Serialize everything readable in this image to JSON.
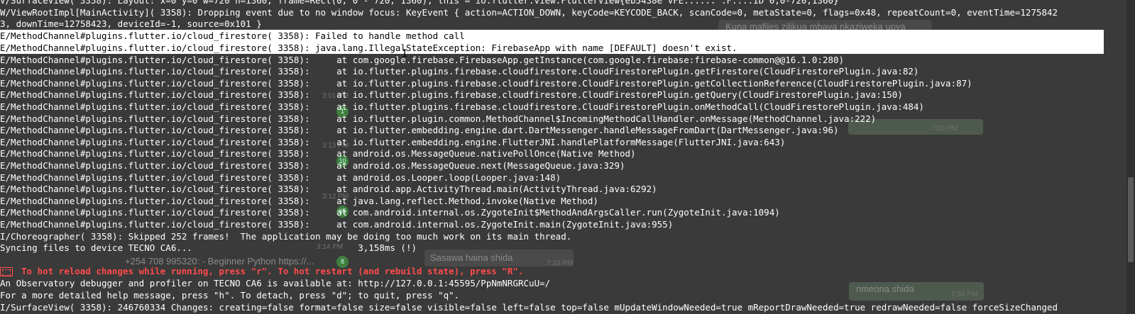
{
  "terminal": {
    "lines": [
      "V/SurfaceView( 3358): Layout: x=0 y=0 w=720 h=1360, frame=Rect(0, 0 - 720, 1360); this = io.flutter.view.FlutterView{eb5438e VFE...... .F....ID 0,0-720,1360}",
      "W/ViewRootImpl[MainActivity]( 3358): Dropping event due to no window focus: KeyEvent { action=ACTION_DOWN, keyCode=KEYCODE_BACK, scanCode=0, metaState=0, flags=0x48, repeatCount=0, eventTime=1275842",
      "3, downTime=12758423, deviceId=-1, source=0x101 }",
      "E/MethodChannel#plugins.flutter.io/cloud_firestore( 3358): Failed to handle method call",
      "E/MethodChannel#plugins.flutter.io/cloud_firestore( 3358): java.lang.IllegalStateException: FirebaseApp with name [DEFAULT] doesn't exist.",
      "E/MethodChannel#plugins.flutter.io/cloud_firestore( 3358):     at com.google.firebase.FirebaseApp.getInstance(com.google.firebase:firebase-common@@16.1.0:280)",
      "E/MethodChannel#plugins.flutter.io/cloud_firestore( 3358):     at io.flutter.plugins.firebase.cloudfirestore.CloudFirestorePlugin.getFirestore(CloudFirestorePlugin.java:82)",
      "E/MethodChannel#plugins.flutter.io/cloud_firestore( 3358):     at io.flutter.plugins.firebase.cloudfirestore.CloudFirestorePlugin.getCollectionReference(CloudFirestorePlugin.java:87)",
      "E/MethodChannel#plugins.flutter.io/cloud_firestore( 3358):     at io.flutter.plugins.firebase.cloudfirestore.CloudFirestorePlugin.getQuery(CloudFirestorePlugin.java:150)",
      "E/MethodChannel#plugins.flutter.io/cloud_firestore( 3358):     at io.flutter.plugins.firebase.cloudfirestore.CloudFirestorePlugin.onMethodCall(CloudFirestorePlugin.java:484)",
      "E/MethodChannel#plugins.flutter.io/cloud_firestore( 3358):     at io.flutter.plugin.common.MethodChannel$IncomingMethodCallHandler.onMessage(MethodChannel.java:222)",
      "E/MethodChannel#plugins.flutter.io/cloud_firestore( 3358):     at io.flutter.embedding.engine.dart.DartMessenger.handleMessageFromDart(DartMessenger.java:96)",
      "E/MethodChannel#plugins.flutter.io/cloud_firestore( 3358):     at io.flutter.embedding.engine.FlutterJNI.handlePlatformMessage(FlutterJNI.java:643)",
      "E/MethodChannel#plugins.flutter.io/cloud_firestore( 3358):     at android.os.MessageQueue.nativePollOnce(Native Method)",
      "E/MethodChannel#plugins.flutter.io/cloud_firestore( 3358):     at android.os.MessageQueue.next(MessageQueue.java:329)",
      "E/MethodChannel#plugins.flutter.io/cloud_firestore( 3358):     at android.os.Looper.loop(Looper.java:148)",
      "E/MethodChannel#plugins.flutter.io/cloud_firestore( 3358):     at android.app.ActivityThread.main(ActivityThread.java:6292)",
      "E/MethodChannel#plugins.flutter.io/cloud_firestore( 3358):     at java.lang.reflect.Method.invoke(Native Method)",
      "E/MethodChannel#plugins.flutter.io/cloud_firestore( 3358):     at com.android.internal.os.ZygoteInit$MethodAndArgsCaller.run(ZygoteInit.java:1094)",
      "E/MethodChannel#plugins.flutter.io/cloud_firestore( 3358):     at com.android.internal.os.ZygoteInit.main(ZygoteInit.java:955)",
      "I/Choreographer( 3358): Skipped 252 frames!  The application may be doing too much work on its main thread.",
      "Syncing files to device TECNO CA6...                               3,158ms (!)",
      "",
      "To hot reload changes while running, press \"r\". To hot restart (and rebuild state), press \"R\".",
      "An Observatory debugger and profiler on TECNO CA6 is available at: http://127.0.0.1:45595/PpNmNRGRCuU=/",
      "For a more detailed help message, press \"h\". To detach, press \"d\"; to quit, press \"q\".",
      "I/SurfaceView( 3358): 246760334 Changes: creating=false format=false size=false visible=false left=false top=false mUpdateWindowNeeded=true mReportDrawNeeded=true redrawNeeded=false forceSizeChanged"
    ]
  },
  "background_chat": {
    "texts": [
      "Kuna mafiles zilikua mbava nkaziweka upya",
      "+254 708 995320: - Beginner Python https://...",
      "Sasawa haina shida",
      "nmeona shida"
    ],
    "times": [
      "3:14 PM",
      "7:33 PM",
      "7:50 PM",
      "7:33 PM",
      "3:01 PM",
      "3:13 PM",
      "3:12 PM"
    ],
    "badges": [
      "1",
      "10",
      "65",
      "8"
    ]
  },
  "colors": {
    "terminal_bg": "#3a3a3a",
    "text": "#ffffff",
    "error_red": "#ff4b4b",
    "highlight_bg": "#ffffff"
  }
}
